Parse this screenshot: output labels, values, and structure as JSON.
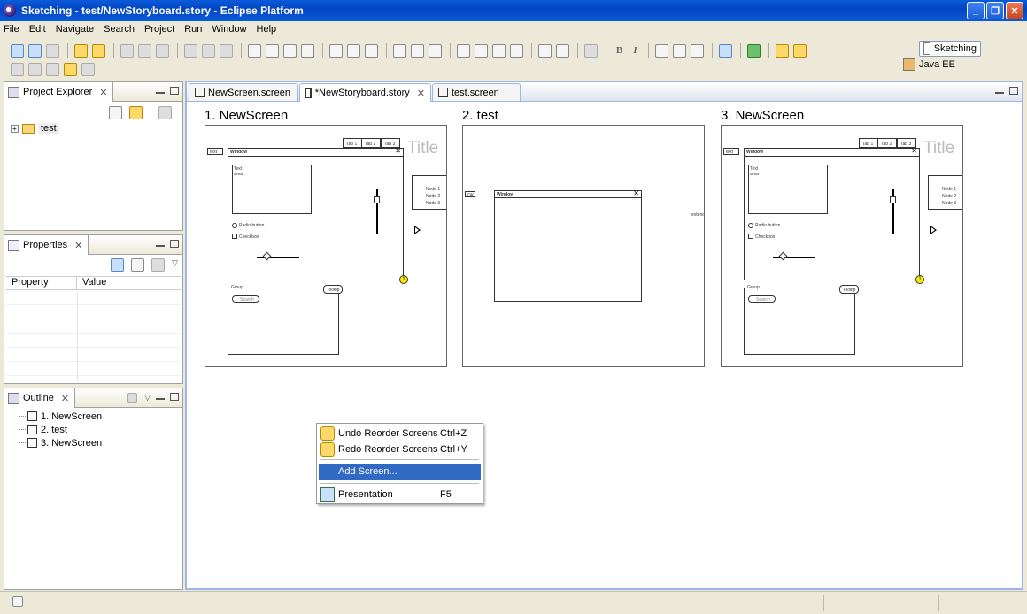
{
  "window": {
    "title": "Sketching - test/NewStoryboard.story - Eclipse Platform",
    "minimize": "_",
    "maximize": "❐",
    "close": "✕"
  },
  "menu": [
    "File",
    "Edit",
    "Navigate",
    "Search",
    "Project",
    "Run",
    "Window",
    "Help"
  ],
  "perspectives": {
    "active": "Sketching",
    "other": "Java EE"
  },
  "project_explorer": {
    "title": "Project Explorer",
    "items": [
      {
        "label": "test"
      }
    ]
  },
  "properties": {
    "title": "Properties",
    "columns": [
      "Property",
      "Value"
    ]
  },
  "outline": {
    "title": "Outline",
    "items": [
      "1. NewScreen",
      "2. test",
      "3. NewScreen"
    ]
  },
  "editor_tabs": [
    {
      "label": "NewScreen.screen",
      "active": false
    },
    {
      "label": "*NewStoryboard.story",
      "active": true
    },
    {
      "label": "test.screen",
      "active": false
    }
  ],
  "screens": [
    {
      "title": "1. NewScreen"
    },
    {
      "title": "2. test"
    },
    {
      "title": "3. NewScreen"
    }
  ],
  "sketch": {
    "tab1": "Tab 1",
    "tab2": "Tab 2",
    "tab3": "Tab 3",
    "window": "Window",
    "title": "Title",
    "text_area": "Text area",
    "radio": "Radio button",
    "checkbox": "Checkbox",
    "group": "Group",
    "search": "Search",
    "tooltip": "Tooltip",
    "node1": "Node 1",
    "node2": "Node 2",
    "node3": "Node 3",
    "text": "text",
    "badge": "1",
    "ok": "OK",
    "extra_label": "extend"
  },
  "context_menu": {
    "items": [
      {
        "label": "Undo Reorder Screens",
        "shortcut": "Ctrl+Z"
      },
      {
        "label": "Redo Reorder Screens",
        "shortcut": "Ctrl+Y"
      },
      {
        "label": "Add Screen...",
        "shortcut": ""
      },
      {
        "label": "Presentation",
        "shortcut": "F5"
      }
    ]
  }
}
